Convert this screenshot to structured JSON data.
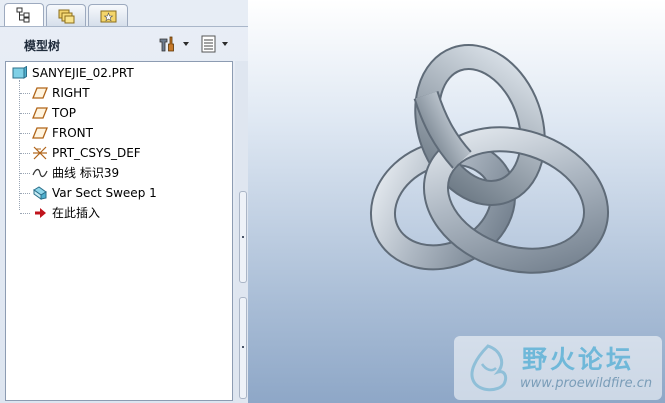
{
  "panel": {
    "title": "模型树",
    "tabs": [
      {
        "name": "model-tree-tab",
        "active": true
      },
      {
        "name": "folder-browser-tab",
        "active": false
      },
      {
        "name": "favorites-tab",
        "active": false
      }
    ]
  },
  "tree": {
    "root": {
      "label": "SANYEJIE_02.PRT",
      "icon": "part-icon"
    },
    "items": [
      {
        "label": "RIGHT",
        "icon": "datum-plane-icon"
      },
      {
        "label": "TOP",
        "icon": "datum-plane-icon"
      },
      {
        "label": "FRONT",
        "icon": "datum-plane-icon"
      },
      {
        "label": "PRT_CSYS_DEF",
        "icon": "coordinate-system-icon"
      },
      {
        "label": "曲线 标识39",
        "icon": "curve-icon"
      },
      {
        "label": "Var Sect Sweep 1",
        "icon": "sweep-icon"
      },
      {
        "label": "在此插入",
        "icon": "insert-here-arrow-icon"
      }
    ]
  },
  "watermark": {
    "title": "野火论坛",
    "url": "www.proewildfire.cn"
  },
  "colors": {
    "viewport_top": "#ffffff",
    "viewport_bottom": "#8ea7c7",
    "knot": "#a4aeb8",
    "insert_arrow": "#c0141c"
  }
}
